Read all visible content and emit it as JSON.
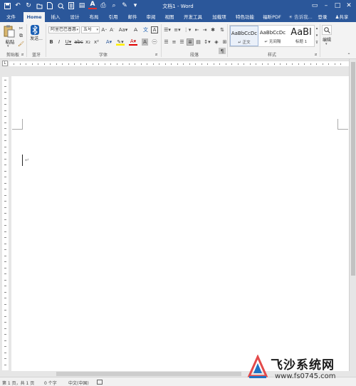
{
  "window": {
    "title": "文档1 - Word"
  },
  "tabs": [
    "文件",
    "Home",
    "插入",
    "设计",
    "布局",
    "引用",
    "邮件",
    "审阅",
    "视图",
    "开发工具",
    "加载项",
    "特色功能",
    "福昕PDF"
  ],
  "active_tab": "Home",
  "tell_me": "告诉我...",
  "login": "登录",
  "share": "共享",
  "clipboard": {
    "paste": "粘贴",
    "label": "剪贴板"
  },
  "bluetooth": {
    "send": "发送...",
    "label": "蓝牙"
  },
  "font": {
    "name": "阿里巴巴普惠",
    "size": "五号",
    "label": "字体"
  },
  "paragraph": {
    "label": "段落"
  },
  "styles": {
    "label": "样式",
    "items": [
      {
        "preview": "AaBbCcDc",
        "name": "↵ 正文"
      },
      {
        "preview": "AaBbCcDc",
        "name": "↵ 无间隔"
      },
      {
        "preview": "AaBl",
        "name": "标题 1"
      }
    ]
  },
  "editing": {
    "label": "编辑"
  },
  "document": {
    "paragraph_mark": "↵"
  },
  "status": {
    "page": "第 1 页，共 1 页",
    "words": "0 个字",
    "language": "中文(中国)"
  },
  "watermark": {
    "text": "飞沙系统网",
    "url": "www.fs0745.com"
  }
}
